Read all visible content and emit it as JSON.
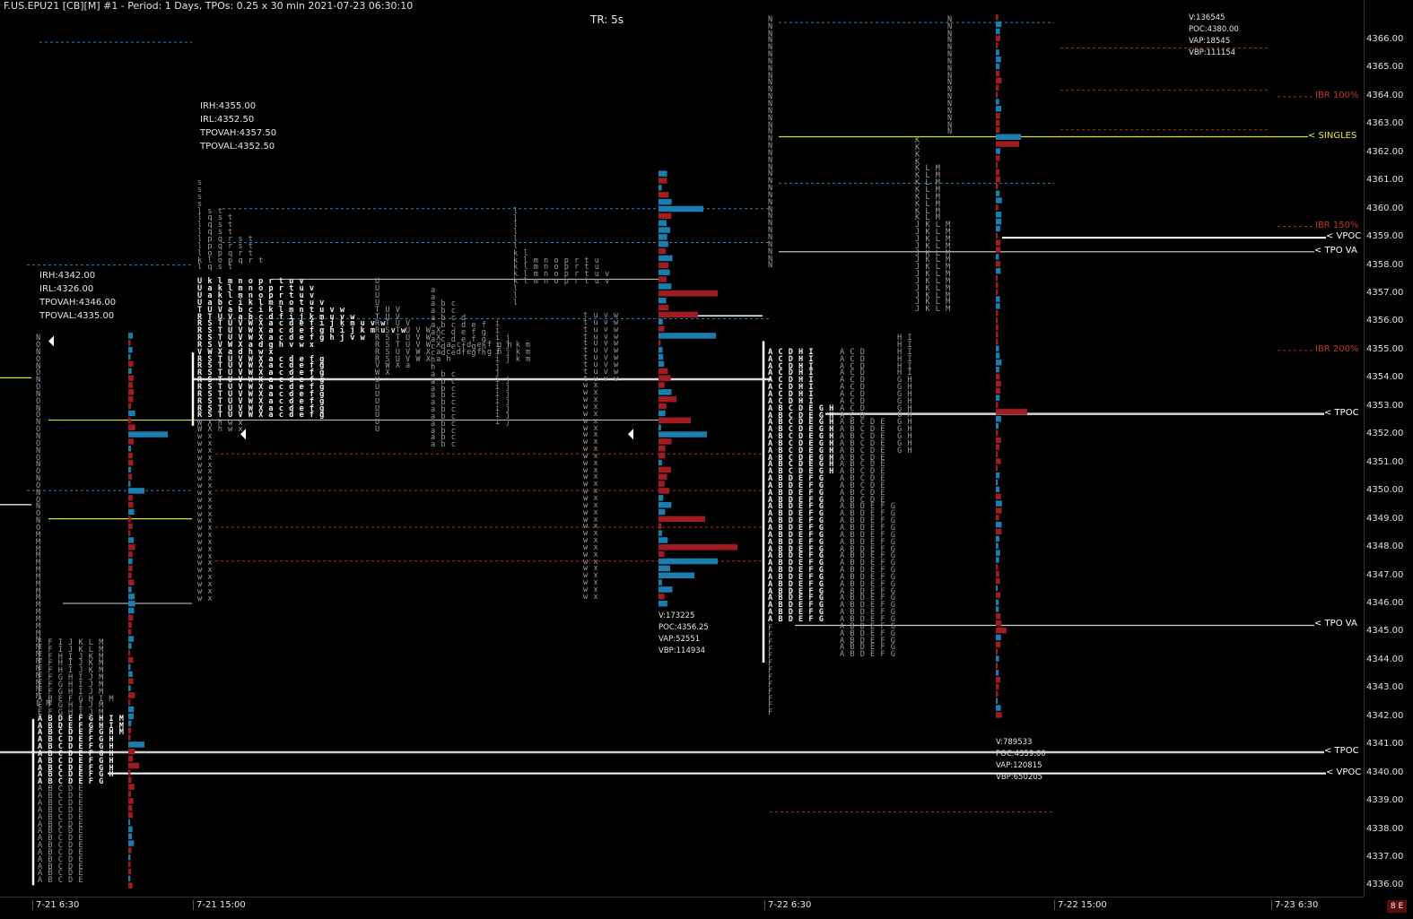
{
  "window": {
    "title": "F.US.EPU21 [CB][M]  #1 - Period: 1 Days, TPOs: 0.25 x 30 min   2021-07-23 06:30:10",
    "tr_label": "TR: 5s",
    "corner_badge": "8 E"
  },
  "colors": {
    "background": "#000000",
    "volume_up": "#1a7fb0",
    "volume_down": "#a01c22",
    "poc_line": "#e8e8e8",
    "singles_line": "#e0e030",
    "value_area_dotted": "#2f7fb8",
    "ib_dotted": "#b22222"
  },
  "y_axis": {
    "min": 4335.6,
    "max": 4367.4,
    "ticks": [
      "4366.00",
      "4365.00",
      "4364.00",
      "4363.00",
      "4362.00",
      "4361.00",
      "4360.00",
      "4359.00",
      "4358.00",
      "4357.00",
      "4356.00",
      "4355.00",
      "4354.00",
      "4353.00",
      "4352.00",
      "4351.00",
      "4350.00",
      "4349.00",
      "4348.00",
      "4347.00",
      "4346.00",
      "4345.00",
      "4344.00",
      "4343.00",
      "4342.00",
      "4341.00",
      "4340.00",
      "4339.00",
      "4338.00",
      "4337.00",
      "4336.00"
    ]
  },
  "x_axis": {
    "labels": [
      "7-21  6:30",
      "7-21  15:00",
      "7-22  6:30",
      "7-22  15:00",
      "7-23  6:30"
    ]
  },
  "sessions": [
    {
      "id": "7-21-rth",
      "stats": [
        "IRH:4342.00",
        "IRL:4326.00",
        "TPOVAH:4346.00",
        "TPOVAL:4335.00"
      ]
    },
    {
      "id": "7-21-eth",
      "stats": [
        "IRH:4355.00",
        "IRL:4352.50",
        "TPOVAH:4357.50",
        "TPOVAL:4352.50"
      ],
      "volume_stats": [
        "V:173225",
        "POC:4356.25",
        "VAP:52551",
        "VBP:114934"
      ]
    },
    {
      "id": "7-22-rth",
      "volume_stats": [
        "V:789533",
        "POC:4359.00",
        "VAP:120815",
        "VBP:650205"
      ]
    },
    {
      "id": "7-22-eth",
      "volume_stats": [
        "V:136545",
        "POC:4380.00",
        "VAP:18545",
        "VBP:111154"
      ]
    }
  ],
  "levels": [
    {
      "label": "IBR 100%",
      "price": 4363.97,
      "color": "#c0392b"
    },
    {
      "label": "< SINGLES",
      "price": 4362.55,
      "color": "#e8e840"
    },
    {
      "label": "IBR 150%",
      "price": 4359.37,
      "color": "#c0392b"
    },
    {
      "label": "< VPOC",
      "price": 4358.97,
      "color": "#ffffff"
    },
    {
      "label": "< TPO VA",
      "price": 4358.47,
      "color": "#ffffff"
    },
    {
      "label": "IBR 200%",
      "price": 4354.97,
      "color": "#c0392b"
    },
    {
      "label": "< TPOC",
      "price": 4352.72,
      "color": "#ffffff"
    },
    {
      "label": "< TPO VA",
      "price": 4345.22,
      "color": "#ffffff"
    },
    {
      "label": "< TPOC",
      "price": 4340.72,
      "color": "#ffffff"
    },
    {
      "label": "< VPOC",
      "price": 4339.97,
      "color": "#ffffff"
    }
  ]
}
